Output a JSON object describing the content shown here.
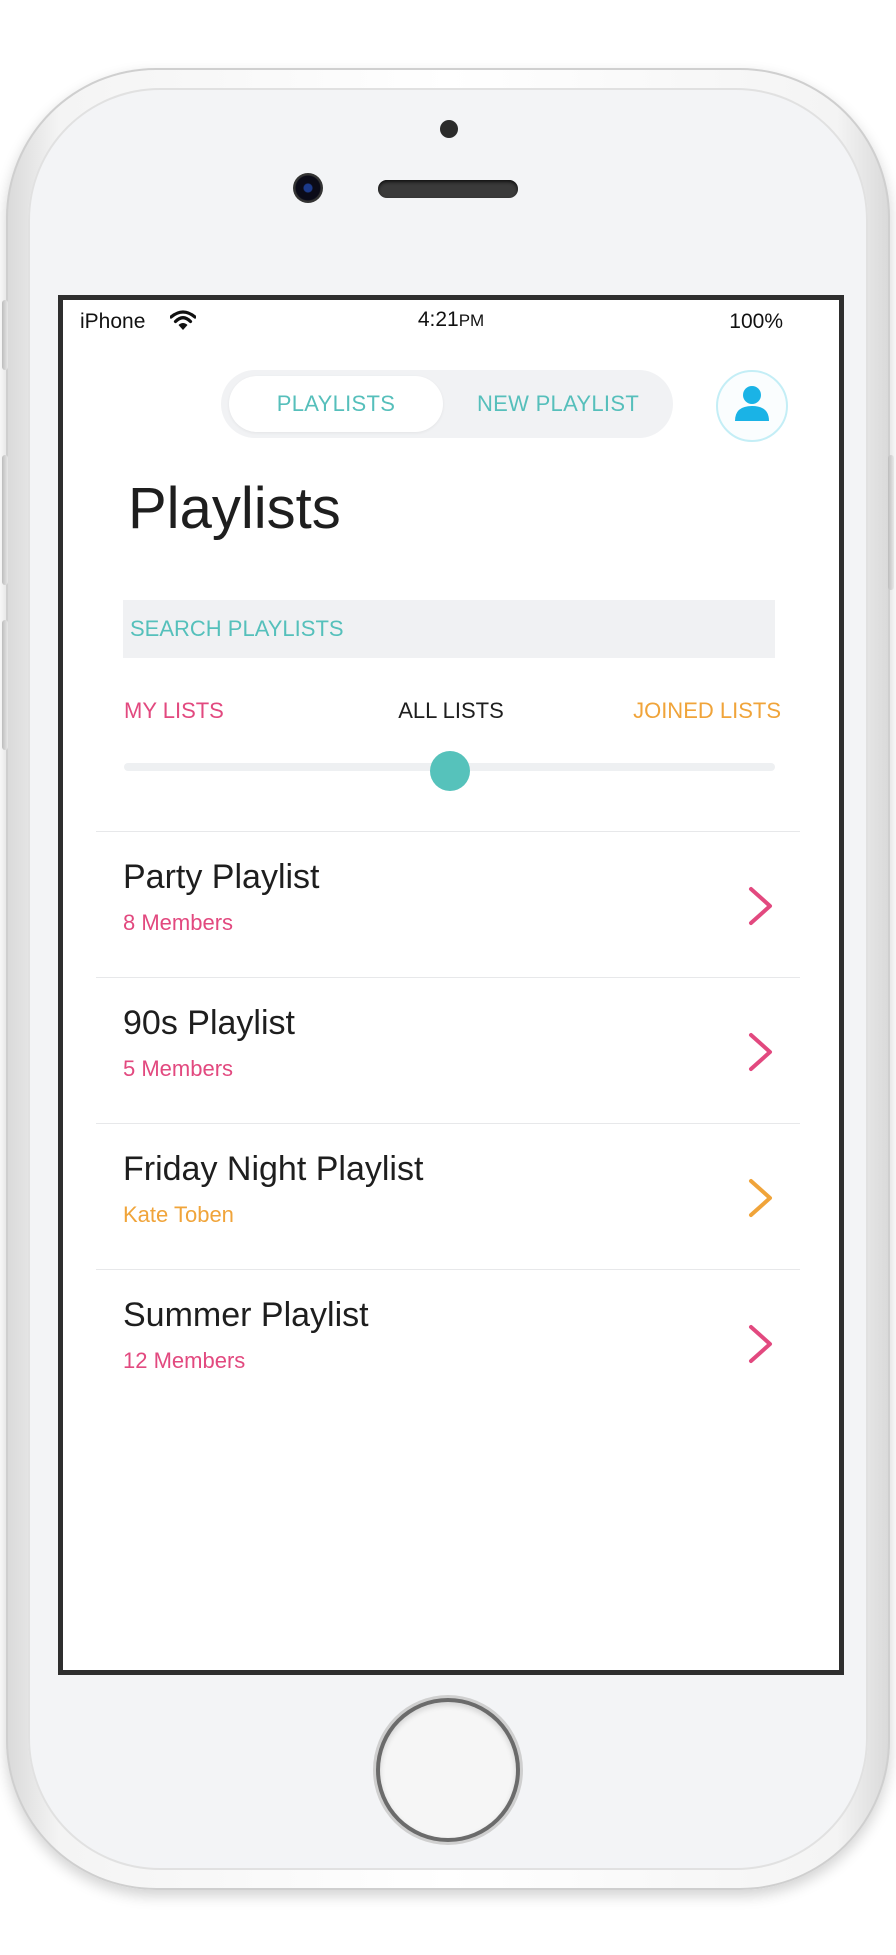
{
  "colors": {
    "accent_teal": "#56c2bb",
    "pink": "#e2497f",
    "orange": "#f0a43a",
    "profile_blue": "#1ab3e6"
  },
  "status_bar": {
    "carrier": "iPhone",
    "time": "4:21",
    "time_suffix": "PM",
    "battery": "100%"
  },
  "segmented_control": {
    "tabs": [
      {
        "label": "PLAYLISTS",
        "active": true
      },
      {
        "label": "NEW PLAYLIST",
        "active": false
      }
    ]
  },
  "profile": {
    "icon": "user-icon"
  },
  "page": {
    "title": "Playlists"
  },
  "search": {
    "placeholder": "SEARCH PLAYLISTS"
  },
  "filter": {
    "options": [
      {
        "label": "MY LISTS",
        "color": "#e2497f"
      },
      {
        "label": "ALL LISTS",
        "color": "#1e1e1e"
      },
      {
        "label": "JOINED LISTS",
        "color": "#f0a43a"
      }
    ],
    "selected": "ALL LISTS",
    "slider_position": 0.5
  },
  "playlists": [
    {
      "title": "Party Playlist",
      "subtitle": "8 Members",
      "color": "#e2497f"
    },
    {
      "title": "90s Playlist",
      "subtitle": "5 Members",
      "color": "#e2497f"
    },
    {
      "title": "Friday Night Playlist",
      "subtitle": "Kate Toben",
      "color": "#f0a43a"
    },
    {
      "title": "Summer Playlist",
      "subtitle": "12 Members",
      "color": "#e2497f"
    }
  ]
}
